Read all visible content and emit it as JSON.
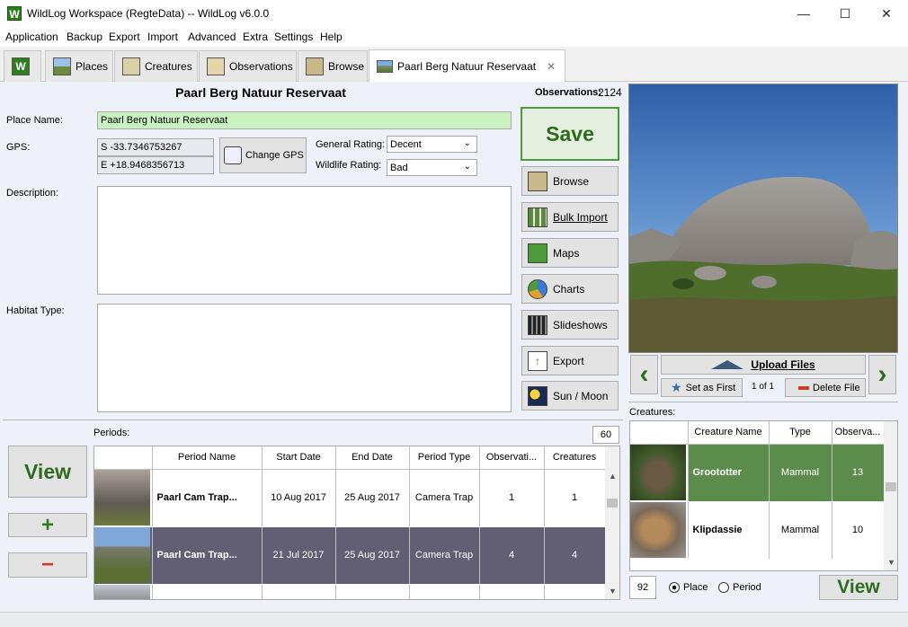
{
  "window": {
    "title": "WildLog Workspace (RegteData) -- WildLog v6.0.0",
    "app_icon_letter": "W",
    "minimize": "—",
    "maximize": "☐",
    "close": "✕"
  },
  "menu": [
    "Application",
    "Backup",
    "Export",
    "Import",
    "Advanced",
    "Extra",
    "Settings",
    "Help"
  ],
  "tabs": [
    {
      "label": "",
      "icon": "wildlog-logo-icon"
    },
    {
      "label": "Places",
      "icon": "landscape-icon"
    },
    {
      "label": "Creatures",
      "icon": "paw-icon"
    },
    {
      "label": "Observations",
      "icon": "notebook-icon"
    },
    {
      "label": "Browse",
      "icon": "book-icon"
    },
    {
      "label": "Paarl Berg Natuur Reservaat",
      "icon": "place-photo-icon",
      "close": "✕"
    }
  ],
  "place": {
    "heading": "Paarl Berg Natuur Reservaat",
    "observations_label": "Observations:",
    "observations_count": "2124",
    "name_label": "Place Name:",
    "name_value": "Paarl Berg Natuur Reservaat",
    "gps_label": "GPS:",
    "gps_lat": "S -33.7346753267",
    "gps_lon": "E +18.9468356713",
    "change_gps": "Change GPS",
    "general_rating_label": "General Rating:",
    "general_rating_value": "Decent",
    "wildlife_rating_label": "Wildlife Rating:",
    "wildlife_rating_value": "Bad",
    "description_label": "Description:",
    "description_value": "",
    "habitat_label": "Habitat Type:",
    "habitat_value": ""
  },
  "actions": {
    "save": "Save",
    "browse": "Browse",
    "bulk_import": "Bulk Import",
    "maps": "Maps",
    "charts": "Charts",
    "slideshows": "Slideshows",
    "export": "Export",
    "sun_moon": "Sun / Moon"
  },
  "image_panel": {
    "upload": "Upload Files",
    "set_first": "Set as First",
    "counter": "1 of 1",
    "delete": "Delete File",
    "prev": "‹",
    "next": "›"
  },
  "periods": {
    "label": "Periods:",
    "count": "60",
    "view": "View",
    "add": "+",
    "remove": "−",
    "columns": [
      "",
      "Period Name",
      "Start Date",
      "End Date",
      "Period Type",
      "Observati...",
      "Creatures"
    ],
    "rows": [
      {
        "name": "Paarl Cam Trap...",
        "start": "10 Aug 2017",
        "end": "25 Aug 2017",
        "type": "Camera Trap",
        "observations": "1",
        "creatures": "1"
      },
      {
        "name": "Paarl Cam Trap...",
        "start": "21 Jul 2017",
        "end": "25 Aug 2017",
        "type": "Camera Trap",
        "observations": "4",
        "creatures": "4"
      }
    ]
  },
  "creatures": {
    "label": "Creatures:",
    "columns": [
      "",
      "Creature Name",
      "Type",
      "Observa..."
    ],
    "rows": [
      {
        "name": "Groototter",
        "type": "Mammal",
        "observations": "13"
      },
      {
        "name": "Klipdassie",
        "type": "Mammal",
        "observations": "10"
      }
    ],
    "count": "92",
    "radio_place": "Place",
    "radio_period": "Period",
    "view": "View"
  },
  "colors": {
    "accent_green": "#2e6b1f",
    "selected_row": "#625e73",
    "selected_creature": "#5b8c4c",
    "name_field_bg": "#c9f2c0"
  }
}
